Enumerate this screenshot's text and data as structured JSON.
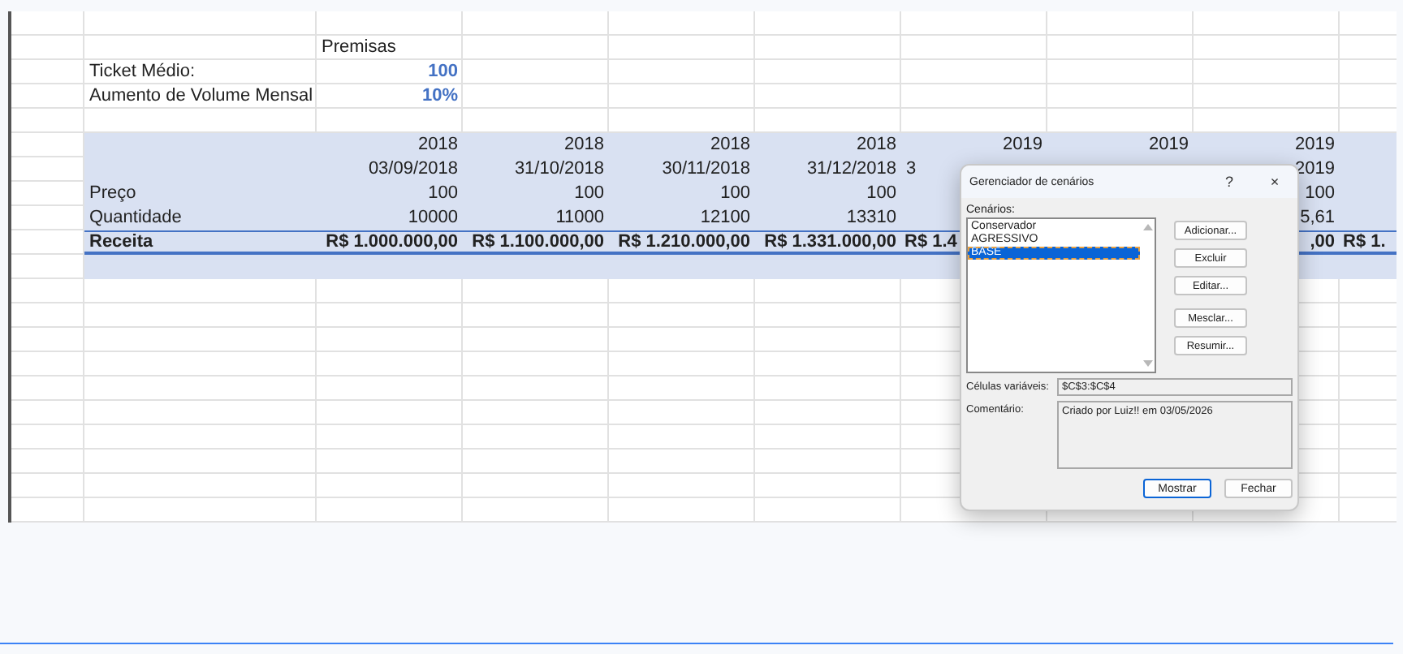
{
  "sheet": {
    "assumptions": {
      "title": "Premisas",
      "items": [
        {
          "label": "Ticket Médio:",
          "value": "100"
        },
        {
          "label": "Aumento de Volume Mensal",
          "value": "10%"
        }
      ]
    },
    "table": {
      "rows": [
        {
          "kind": "header",
          "cells": [
            "2018",
            "2018",
            "2018",
            "2018",
            "2019",
            "2019",
            "2019",
            null
          ]
        },
        {
          "kind": "header",
          "cells": [
            "03/09/2018",
            "31/10/2018",
            "30/11/2018",
            "31/12/2018",
            {
              "text": "3",
              "clipped": true
            },
            null,
            "2019",
            null
          ]
        },
        {
          "kind": "data",
          "label": "Preço",
          "cells": [
            "100",
            "100",
            "100",
            "100",
            null,
            null,
            "100",
            null
          ]
        },
        {
          "kind": "data",
          "label": "Quantidade",
          "cells": [
            "10000",
            "11000",
            "12100",
            "13310",
            null,
            null,
            "5,61",
            null
          ]
        },
        {
          "kind": "total",
          "label": "Receita",
          "cells": [
            "R$ 1.000.000,00",
            "R$ 1.100.000,00",
            "R$ 1.210.000,00",
            "R$ 1.331.000,00",
            {
              "text": "R$ 1.4",
              "clipped": true
            },
            null,
            ",00",
            {
              "text": "R$ 1.",
              "clipped": true
            }
          ]
        }
      ]
    }
  },
  "dialog": {
    "title": "Gerenciador de cenários",
    "help": "?",
    "close": "×",
    "list_label": "Cenários:",
    "scenarios": [
      {
        "name": "Conservador",
        "selected": false
      },
      {
        "name": "AGRESSIVO",
        "selected": false
      },
      {
        "name": "BASE",
        "selected": true
      }
    ],
    "side_buttons": [
      [
        "Adicionar...",
        "Excluir",
        "Editar..."
      ],
      [
        "Mesclar...",
        "Resumir..."
      ]
    ],
    "changing_cells": {
      "label": "Células variáveis:",
      "value": "$C$3:$C$4"
    },
    "comment": {
      "label": "Comentário:",
      "value": "Criado por Luiz!! em 03/05/2026"
    },
    "buttons": [
      {
        "label": "Mostrar",
        "default": true
      },
      {
        "label": "Fechar",
        "default": false
      }
    ]
  }
}
